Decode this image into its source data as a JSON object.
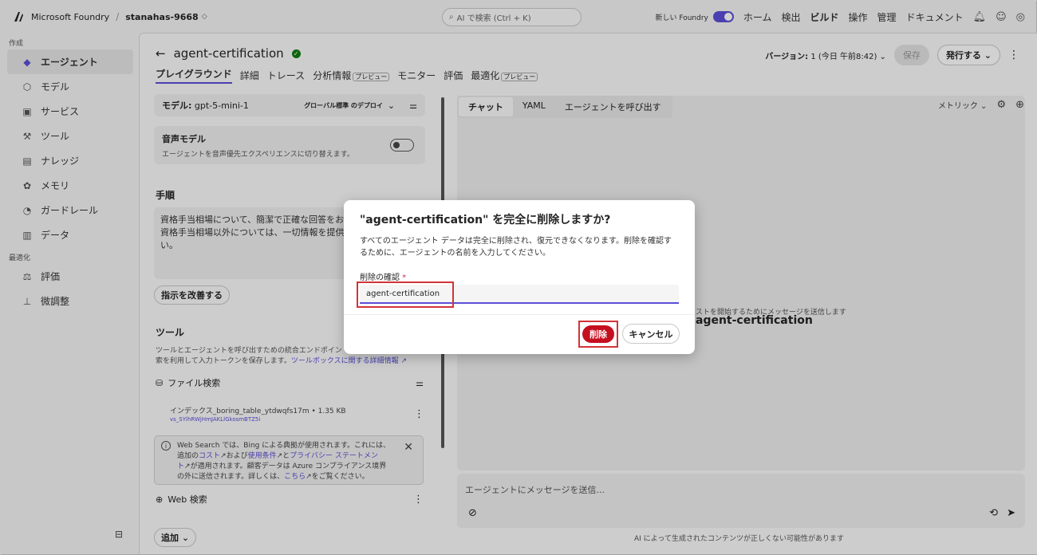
{
  "topbar": {
    "brand": "Microsoft Foundry",
    "separator": "/",
    "project": "stanahas-9668",
    "search_placeholder": "AI で検索 (Ctrl + K)",
    "new_foundry_label": "新しい Foundry",
    "nav": [
      "ホーム",
      "検出",
      "ビルド",
      "操作",
      "管理",
      "ドキュメント"
    ],
    "active_nav": "ビルド"
  },
  "sidebar": {
    "section_create": "作成",
    "items": [
      {
        "label": "エージェント",
        "icon": "agent-icon",
        "active": true
      },
      {
        "label": "モデル",
        "icon": "model-icon"
      },
      {
        "label": "サービス",
        "icon": "service-icon"
      },
      {
        "label": "ツール",
        "icon": "tool-icon"
      },
      {
        "label": "ナレッジ",
        "icon": "knowledge-icon"
      },
      {
        "label": "メモリ",
        "icon": "memory-icon"
      },
      {
        "label": "ガードレール",
        "icon": "guardrail-icon"
      },
      {
        "label": "データ",
        "icon": "data-icon"
      }
    ],
    "section_optimize": "最適化",
    "optimize_items": [
      {
        "label": "評価",
        "icon": "evaluation-icon"
      },
      {
        "label": "微調整",
        "icon": "finetune-icon"
      }
    ]
  },
  "header": {
    "back_arrow": "←",
    "title": "agent-certification",
    "tabs": [
      "プレイグラウンド",
      "詳細",
      "トレース",
      "分析情報",
      "モニター",
      "評価",
      "最適化"
    ],
    "preview_badge": "プレビュー",
    "version_label": "バージョン:",
    "version_value": "1 (今日 午前8:42)",
    "save_label": "保存",
    "publish_label": "発行する"
  },
  "left_panel": {
    "model_label": "モデル:",
    "model_value": "gpt-5-mini-1",
    "deploy_tag": "グローバル標準 のデプロイ",
    "voice_title": "音声モデル",
    "voice_desc": "エージェントを音声優先エクスペリエンスに切り替えます。",
    "instructions_title": "手順",
    "instructions_text_1": "資格手当相場について、簡潔で正確な回答をお",
    "instructions_text_2": "資格手当相場以外については、一切情報を提供",
    "instructions_text_3": "い。",
    "improve_label": "指示を改善する",
    "tools_title": "ツール",
    "tools_desc_1": "ツールとエージェントを呼び出すための統合エンドポイン",
    "tools_desc_2": "索を利用して入力トークンを保存します。",
    "tools_link": "ツールボックスに関する詳細情報",
    "file_search_label": "ファイル検索",
    "index_name": "インデックス_boring_table_ytdwqfs17m • 1.35 KB",
    "index_id": "vs_SYlhRWjHmJAKLlGkosmBTZ5i",
    "info_text_1": "Web Search では、Bing による典拠が使用されます。これには、",
    "info_text_2a": "追加の",
    "info_link_cost": "コスト",
    "info_text_2b": "および",
    "info_link_terms": "使用条件",
    "info_text_2c": "と",
    "info_link_privacy": "プライバシー ステートメン",
    "info_link_privacy2": "ト",
    "info_text_3": "が適用されます。顧客データは Azure コンプライアンス境界",
    "info_text_4a": "の外に送信されます。詳しくは、",
    "info_link_here": "こちら",
    "info_text_4b": "をご覧ください。",
    "web_search_label": "Web 検索",
    "add_label": "追加"
  },
  "right_panel": {
    "tabs": [
      "チャット",
      "YAML",
      "エージェントを呼び出す"
    ],
    "metrics_label": "メトリック",
    "agent_name": "agent-certification",
    "agent_sub": "ストを開始するためにメッセージを送信します",
    "composer_placeholder": "エージェントにメッセージを送信...",
    "disclaimer": "AI によって生成されたコンテンツが正しくない可能性があります"
  },
  "dialog": {
    "title": "\"agent-certification\" を完全に削除しますか?",
    "body": "すべてのエージェント データは完全に削除され、復元できなくなります。削除を確認するために、エージェントの名前を入力してください。",
    "field_label": "削除の確認",
    "required_mark": "*",
    "input_value": "agent-certification",
    "delete_label": "削除",
    "cancel_label": "キャンセル"
  },
  "colors": {
    "accent": "#5b4fd6",
    "danger": "#c50f1f",
    "highlight": "#d13438",
    "success": "#107c10"
  }
}
